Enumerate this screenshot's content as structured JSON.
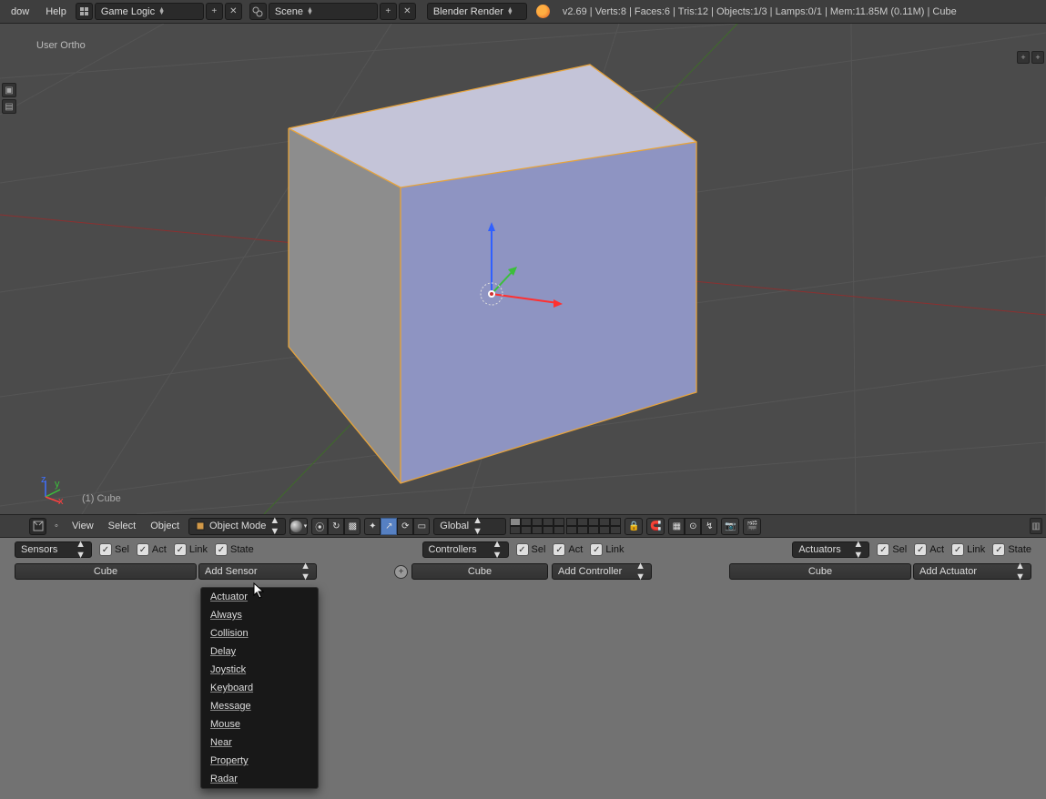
{
  "header": {
    "menu": [
      "dow",
      "Help"
    ],
    "screen_layout": "Game Logic",
    "scene": "Scene",
    "render_engine": "Blender Render",
    "status": "v2.69 | Verts:8 | Faces:6 | Tris:12 | Objects:1/3 | Lamps:0/1 | Mem:11.85M (0.11M) | Cube"
  },
  "viewport": {
    "view_label": "User Ortho",
    "object_label": "(1) Cube",
    "axes": {
      "x": "x",
      "y": "y",
      "z": "z"
    }
  },
  "view_toolbar": {
    "menus": [
      "View",
      "Select",
      "Object"
    ],
    "mode": "Object Mode",
    "orientation": "Global"
  },
  "logic": {
    "sensors": {
      "title": "Sensors",
      "checks": [
        "Sel",
        "Act",
        "Link",
        "State"
      ],
      "obj": "Cube",
      "add": "Add Sensor"
    },
    "controllers": {
      "title": "Controllers",
      "checks": [
        "Sel",
        "Act",
        "Link"
      ],
      "obj": "Cube",
      "add": "Add Controller"
    },
    "actuators": {
      "title": "Actuators",
      "checks": [
        "Sel",
        "Act",
        "Link",
        "State"
      ],
      "obj": "Cube",
      "add": "Add Actuator"
    }
  },
  "dropdown": {
    "items": [
      "Actuator",
      "Always",
      "Collision",
      "Delay",
      "Joystick",
      "Keyboard",
      "Message",
      "Mouse",
      "Near",
      "Property",
      "Radar"
    ]
  }
}
